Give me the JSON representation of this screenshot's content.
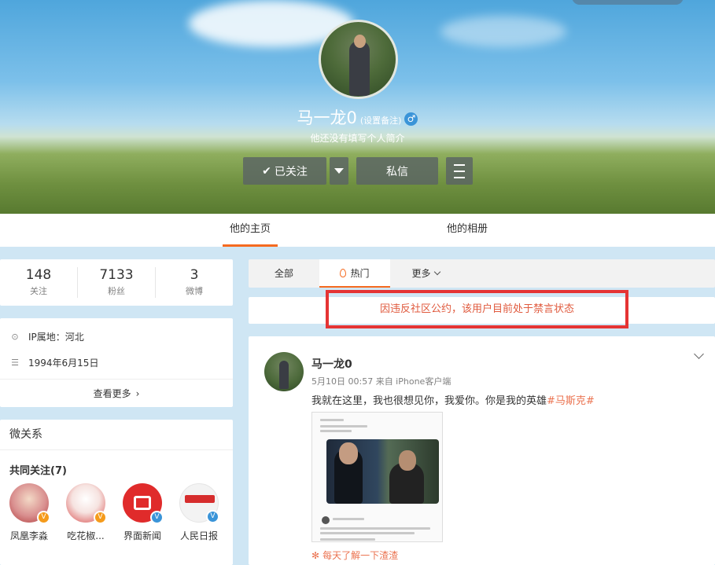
{
  "profile": {
    "name": "马一龙0",
    "remark_link": "(设置备注)",
    "gender_icon": "male-icon",
    "gender_symbol": "♂",
    "bio": "他还没有填写个人简介"
  },
  "actions": {
    "follow_label": "已关注",
    "follow_icon": "check-icon",
    "message_label": "私信"
  },
  "tabs": [
    {
      "label": "他的主页",
      "active": true
    },
    {
      "label": "他的相册",
      "active": false
    }
  ],
  "stats": [
    {
      "value": "148",
      "label": "关注"
    },
    {
      "value": "7133",
      "label": "粉丝"
    },
    {
      "value": "3",
      "label": "微博"
    }
  ],
  "info": {
    "ip_location": "IP属地：河北",
    "birthday": "1994年6月15日",
    "see_more": "查看更多"
  },
  "relations": {
    "title": "微关系",
    "common_follow_title": "共同关注(7)",
    "people": [
      {
        "name": "凤凰李淼",
        "badge": "V",
        "badge_color": "#f59b1b"
      },
      {
        "name": "吃花椒...",
        "badge": "V",
        "badge_color": "#f59b1b"
      },
      {
        "name": "界面新闻",
        "badge": "V",
        "badge_color": "#3a94d8"
      },
      {
        "name": "人民日报",
        "badge": "V",
        "badge_color": "#3a94d8"
      }
    ]
  },
  "filters": {
    "all": "全部",
    "hot": "热门",
    "more": "更多"
  },
  "notice": "因违反社区公约，该用户目前处于禁言状态",
  "post": {
    "author": "马一龙0",
    "meta": "5月10日 00:57 来自 iPhone客户端",
    "text_main": "我就在这里，我也很想见你，我爱你。你是我的英雄",
    "hashtag": "#马斯克#",
    "daily_link": "每天了解一下渣渣"
  },
  "colors": {
    "accent": "#f56a20",
    "notice_border": "#e53434",
    "notice_text": "#e05a3e",
    "link_orange": "#eb7350",
    "page_bg": "#cfe6f4"
  }
}
